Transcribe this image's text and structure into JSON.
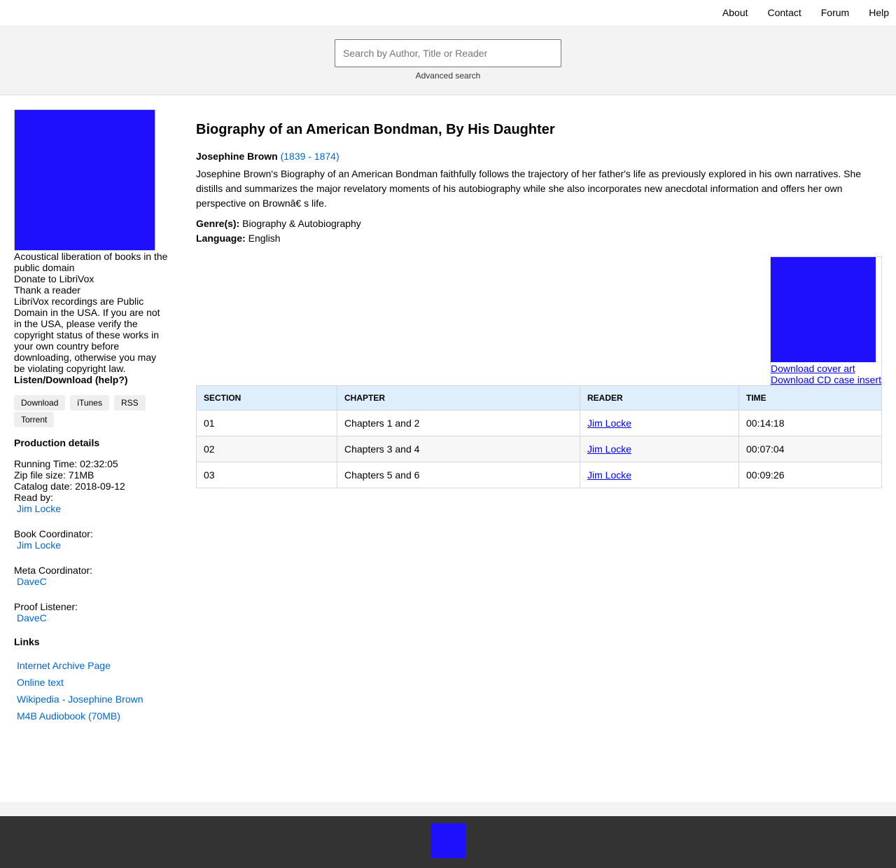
{
  "nav": {
    "items": [
      "About",
      "Contact",
      "Forum",
      "Help"
    ]
  },
  "search": {
    "placeholder": "Search by Author, Title or Reader",
    "advanced": "Advanced search"
  },
  "sidebar": {
    "tagline": "Acoustical liberation of books in the public domain",
    "donate": "Donate to LibriVox",
    "thank": "Thank a reader",
    "notice": "LibriVox recordings are Public Domain in the USA. If you are not in the USA, please verify the copyright status of these works in your own country before downloading, otherwise you may be violating copyright law.",
    "listen_heading": "Listen/Download (help?)",
    "buttons": [
      "Download",
      "iTunes",
      "RSS",
      "Torrent"
    ],
    "production_heading": "Production details",
    "running_time": "Running Time: 02:32:05",
    "zip_size": "Zip file size: 71MB",
    "catalog_date": "Catalog date: 2018-09-12",
    "read_by_label": "Read by:",
    "read_by": "Jim Locke",
    "book_coord_label": "Book Coordinator:",
    "book_coord": "Jim Locke",
    "meta_coord_label": "Meta Coordinator:",
    "meta_coord": "DaveC",
    "proof_label": "Proof Listener:",
    "proof": "DaveC",
    "links_heading": "Links",
    "links": [
      "Internet Archive Page",
      "Online text",
      "Wikipedia - Josephine Brown",
      "M4B Audiobook (70MB)"
    ]
  },
  "book": {
    "title": "Biography of an American Bondman, By His Daughter",
    "author": "Josephine Brown",
    "author_dates": "(1839 - 1874)",
    "description": "Josephine Brown's Biography of an American Bondman faithfully follows the trajectory of her father's life as previously explored in his own narratives. She distills and summarizes the major revelatory moments of his autobiography while she also incorporates new anecdotal information and offers her own perspective on Brownâ€   s life.",
    "genre_label": "Genre(s):",
    "genre": "Biography & Autobiography",
    "language_label": "Language:",
    "language": "English",
    "download_cover": "Download cover art",
    "download_cd": "Download CD case insert"
  },
  "table": {
    "headers": [
      "SECTION",
      "CHAPTER",
      "READER",
      "TIME"
    ],
    "rows": [
      [
        "01",
        "Chapters 1 and 2",
        "Jim Locke",
        "00:14:18"
      ],
      [
        "02",
        "Chapters 3 and 4",
        "Jim Locke",
        "00:07:04"
      ],
      [
        "03",
        "Chapters 5 and 6",
        "Jim Locke",
        "00:09:26"
      ]
    ]
  },
  "colors": {
    "cover_placeholder": "#1f10fb",
    "link": "#0066cc",
    "table_header": "#deeefc",
    "footer": "#333333"
  }
}
